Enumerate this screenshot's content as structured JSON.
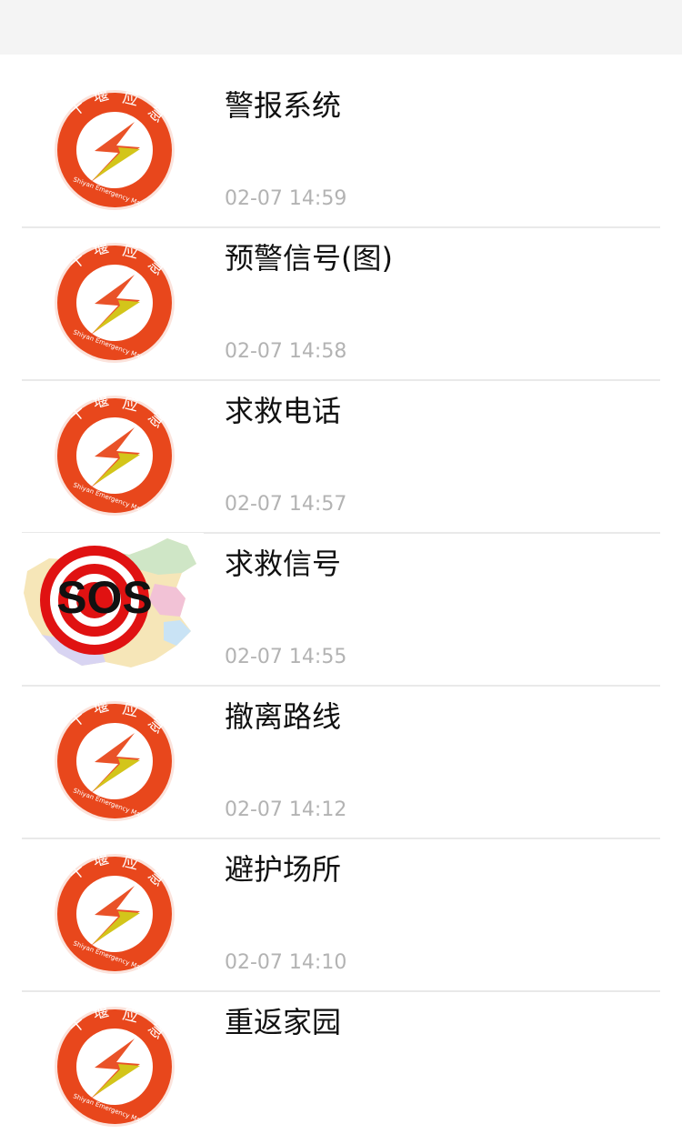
{
  "colors": {
    "logo_ring": "#e8471c",
    "logo_bolt_top": "#e8491c",
    "logo_bolt_bottom": "#d3c51a",
    "sos_red": "#e01212",
    "timestamp": "#b3b3b3",
    "divider": "#e9e9e9",
    "top_bar": "#f4f4f4"
  },
  "logo_text": {
    "top": "十 堰 应 急",
    "bottom": "Shiyan Emergency Management",
    "sos": "SOS"
  },
  "items": [
    {
      "icon": "shiyan-emergency-logo-icon",
      "title": "警报系统",
      "time": "02-07 14:59"
    },
    {
      "icon": "shiyan-emergency-logo-icon",
      "title": "预警信号(图)",
      "time": "02-07 14:58"
    },
    {
      "icon": "shiyan-emergency-logo-icon",
      "title": "求救电话",
      "time": "02-07 14:57"
    },
    {
      "icon": "sos-map-icon",
      "title": "求救信号",
      "time": "02-07 14:55"
    },
    {
      "icon": "shiyan-emergency-logo-icon",
      "title": "撤离路线",
      "time": "02-07 14:12"
    },
    {
      "icon": "shiyan-emergency-logo-icon",
      "title": "避护场所",
      "time": "02-07 14:10"
    },
    {
      "icon": "shiyan-emergency-logo-icon",
      "title": "重返家园",
      "time": ""
    }
  ]
}
